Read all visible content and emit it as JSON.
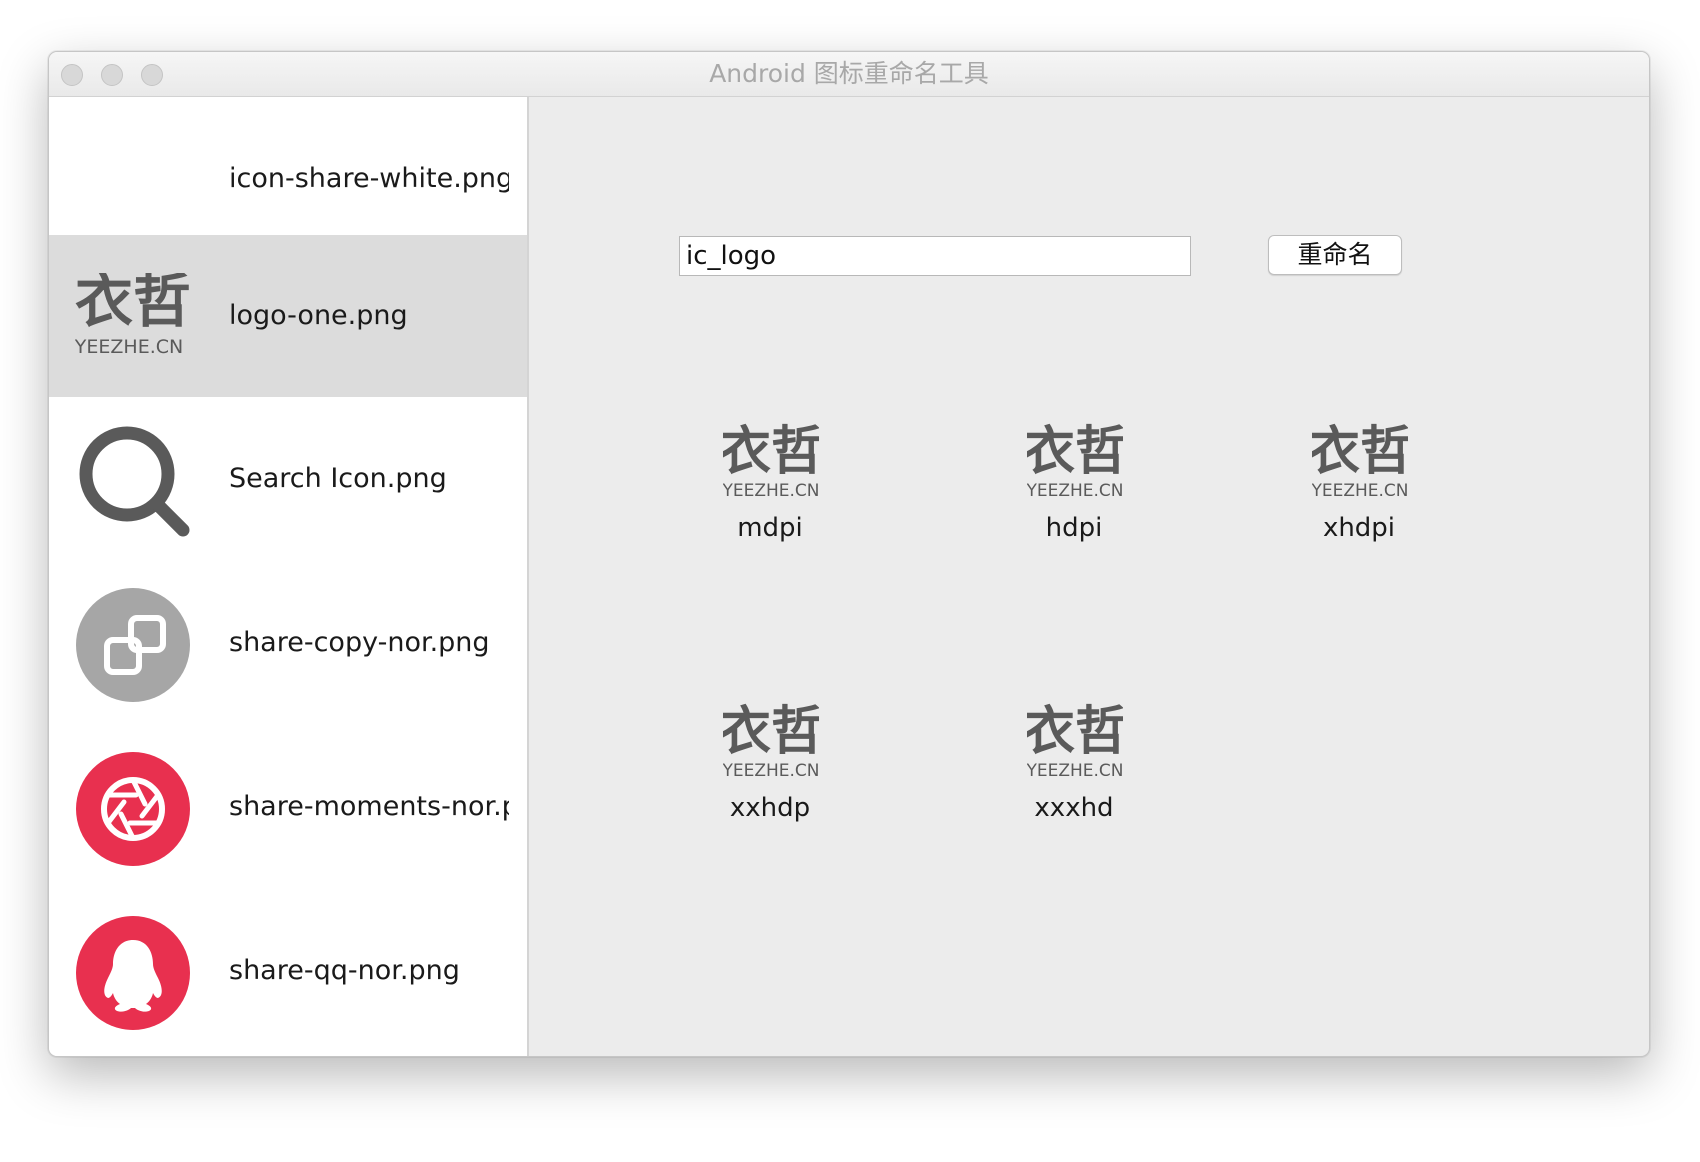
{
  "window": {
    "title": "Android 图标重命名工具"
  },
  "file_list": {
    "items": [
      {
        "label": "icon-share-white.png",
        "icon": "blank-white-icon",
        "selected": false
      },
      {
        "label": "logo-one.png",
        "icon": "yeezhe-logo-icon",
        "selected": true
      },
      {
        "label": "Search Icon.png",
        "icon": "search-icon",
        "selected": false
      },
      {
        "label": "share-copy-nor.png",
        "icon": "copy-icon",
        "selected": false
      },
      {
        "label": "share-moments-nor.pn",
        "icon": "moments-shutter-icon",
        "selected": false
      },
      {
        "label": "share-qq-nor.png",
        "icon": "qq-penguin-icon",
        "selected": false
      }
    ]
  },
  "rename": {
    "input_value": "ic_logo",
    "button_label": "重命名"
  },
  "densities": [
    {
      "label": "mdpi"
    },
    {
      "label": "hdpi"
    },
    {
      "label": "xhdpi"
    },
    {
      "label": "xxhdp"
    },
    {
      "label": "xxxhd"
    }
  ],
  "logo": {
    "glyphs": "衣哲",
    "caption": "YEEZHE.CN"
  },
  "colors": {
    "selected_row": "#dcdcdc",
    "content_bg": "#ececec",
    "accent_red": "#e8304f",
    "gray_icon": "#a6a6a6",
    "logo_gray": "#5a5a5a"
  }
}
